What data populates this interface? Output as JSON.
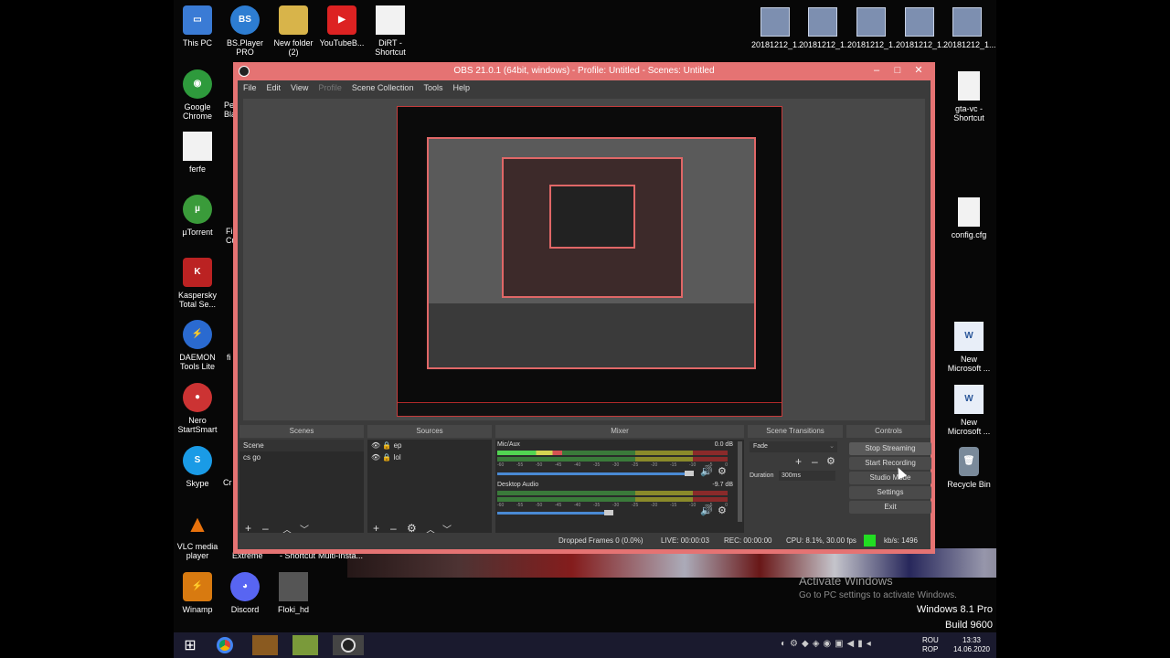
{
  "desktop": {
    "icons_left": [
      {
        "label": "This PC",
        "icon": "computer-icon",
        "color": "#3a7bd5",
        "glyph": "▭"
      },
      {
        "label": "BS.Player PRO",
        "icon": "bsplayer-icon",
        "color": "#2d7dd2",
        "glyph": "BS"
      },
      {
        "label": "New folder (2)",
        "icon": "folder-icon",
        "color": "#d8b44a",
        "glyph": "▯"
      },
      {
        "label": "YouTubeB...",
        "icon": "youtube-icon",
        "color": "#d22",
        "glyph": "You"
      },
      {
        "label": "DiRT - Shortcut",
        "icon": "file-icon",
        "color": "#f2f2f2",
        "glyph": ""
      }
    ],
    "icons_column": [
      {
        "label": "Google Chrome",
        "icon": "chrome-icon",
        "color": "#2e9a3c",
        "glyph": "◉"
      },
      {
        "label": "ferfe",
        "icon": "file-icon",
        "color": "#f2f2f2",
        "glyph": ""
      },
      {
        "label": "µTorrent",
        "icon": "utorrent-icon",
        "color": "#3a9b3a",
        "glyph": "µ"
      },
      {
        "label": "Kaspersky Total Se...",
        "icon": "kaspersky-icon",
        "color": "#b22",
        "glyph": "K"
      },
      {
        "label": "DAEMON Tools Lite",
        "icon": "daemon-tools-icon",
        "color": "#2a6ad0",
        "glyph": "⚡"
      },
      {
        "label": "Nero StartSmart",
        "icon": "nero-icon",
        "color": "#c33",
        "glyph": "●"
      },
      {
        "label": "Skype",
        "icon": "skype-icon",
        "color": "#1a9be6",
        "glyph": "S"
      },
      {
        "label": "VLC media player",
        "icon": "vlc-icon",
        "color": "#e8720c",
        "glyph": "▲"
      },
      {
        "label": "Winamp",
        "icon": "winamp-icon",
        "color": "#d87a10",
        "glyph": "⚡"
      }
    ],
    "icons_bottom": [
      {
        "label": "Discord",
        "icon": "discord-icon",
        "color": "#5865f2",
        "glyph": "◕"
      },
      {
        "label": "Floki_hd",
        "icon": "image-file-icon",
        "color": "#555",
        "glyph": ""
      }
    ],
    "partial_labels": [
      "Pe",
      "Bla",
      "Fi",
      "Cu",
      "fi",
      "Cr",
      "Extreme",
      "- Shortcut",
      "Multi-Insta..."
    ],
    "thumbnails": [
      "20181212_1...",
      "20181212_1...",
      "20181212_1...",
      "20181212_1...",
      "20181212_1..."
    ],
    "icons_right": [
      {
        "label": "gta-vc - Shortcut",
        "icon": "file-icon"
      },
      {
        "label": "config.cfg",
        "icon": "file-icon"
      },
      {
        "label": "New Microsoft ...",
        "icon": "word-doc-icon"
      },
      {
        "label": "New Microsoft ...",
        "icon": "word-doc-icon"
      },
      {
        "label": "Recycle Bin",
        "icon": "recycle-bin-icon"
      }
    ],
    "watermark": {
      "title": "Activate Windows",
      "subtitle": "Go to PC settings to activate Windows.",
      "edition": "Windows 8.1 Pro",
      "build": "Build 9600"
    }
  },
  "obs": {
    "title": "OBS 21.0.1 (64bit, windows) - Profile: Untitled - Scenes: Untitled",
    "window_controls": {
      "minimize": "–",
      "maximize": "□",
      "close": "✕"
    },
    "menu": [
      "File",
      "Edit",
      "View",
      "Profile",
      "Scene Collection",
      "Tools",
      "Help"
    ],
    "menu_disabled": "Profile",
    "panels": {
      "scenes": {
        "header": "Scenes",
        "items": [
          "Scene",
          "cs go"
        ]
      },
      "sources": {
        "header": "Sources",
        "items": [
          "ep",
          "lol"
        ]
      },
      "mixer": {
        "header": "Mixer",
        "channels": [
          {
            "name": "Mic/Aux",
            "db": "0.0 dB",
            "level": 0.28,
            "volume": 1.0
          },
          {
            "name": "Desktop Audio",
            "db": "-9.7 dB",
            "level": 0.0,
            "volume": 0.58
          }
        ],
        "scale": [
          "-60",
          "-55",
          "-50",
          "-45",
          "-40",
          "-35",
          "-30",
          "-25",
          "-20",
          "-15",
          "-10",
          "-5",
          "0"
        ]
      },
      "transitions": {
        "header": "Scene Transitions",
        "selected": "Fade",
        "duration_label": "Duration",
        "duration_value": "300ms"
      },
      "controls": {
        "header": "Controls",
        "buttons": [
          "Stop Streaming",
          "Start Recording",
          "Studio Mode",
          "Settings",
          "Exit"
        ]
      }
    },
    "status": {
      "dropped": "Dropped Frames 0 (0.0%)",
      "live": "LIVE: 00:00:03",
      "rec": "REC: 00:00:00",
      "cpu": "CPU: 8.1%, 30.00 fps",
      "kbps": "kb/s: 1496",
      "indicator_color": "#22dd22"
    }
  },
  "taskbar": {
    "apps": [
      "start-button",
      "chrome-icon",
      "cs-go-icon",
      "minecraft-icon",
      "obs-icon"
    ],
    "lang": [
      "ROU",
      "ROP"
    ],
    "time": "13:33",
    "date": "14.06.2020"
  }
}
